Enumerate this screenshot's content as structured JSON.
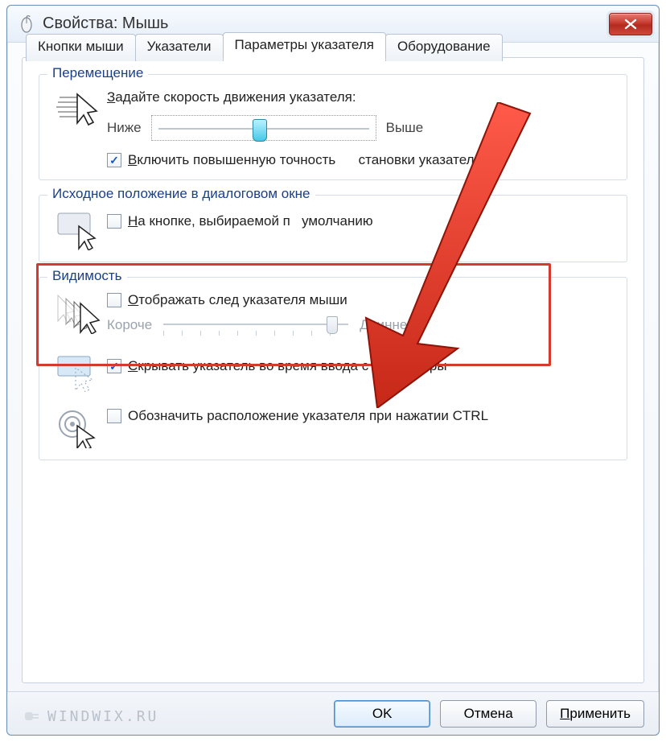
{
  "window": {
    "title": "Свойства: Мышь"
  },
  "tabs": {
    "t0": "Кнопки мыши",
    "t1": "Указатели",
    "t2": "Параметры указателя",
    "t3": "Оборудование"
  },
  "motion": {
    "legend": "Перемещение",
    "label": "Задайте скорость движения указателя:",
    "label_ul": "З",
    "slow": "Ниже",
    "fast": "Выше",
    "slider_value": 45,
    "precision": "Включить повышенную точность установки указателя",
    "precision_ul": "В",
    "precision_checked": true,
    "precision_suffix": "становки указателя"
  },
  "snapTo": {
    "legend": "Исходное положение в диалоговом окне",
    "label": "На кнопке, выбираемой по умолчанию",
    "label_ul": "Н",
    "checked": false,
    "label_suffix": "умолчанию"
  },
  "visibility": {
    "legend": "Видимость",
    "trail": "Отображать след указателя мыши",
    "trail_ul": "О",
    "trail_checked": false,
    "short": "Короче",
    "long": "Длиннее",
    "trail_value": 88,
    "hide": "Скрывать указатель во время ввода с клавиатуры",
    "hide_ul": "С",
    "hide_checked": true,
    "ctrl": "Обозначить расположение указателя при нажатии CTRL",
    "ctrl_checked": false
  },
  "buttons": {
    "ok": "OK",
    "cancel": "Отмена",
    "apply": "Применить",
    "apply_ul": "П"
  },
  "watermark": "WINDWIX.RU"
}
